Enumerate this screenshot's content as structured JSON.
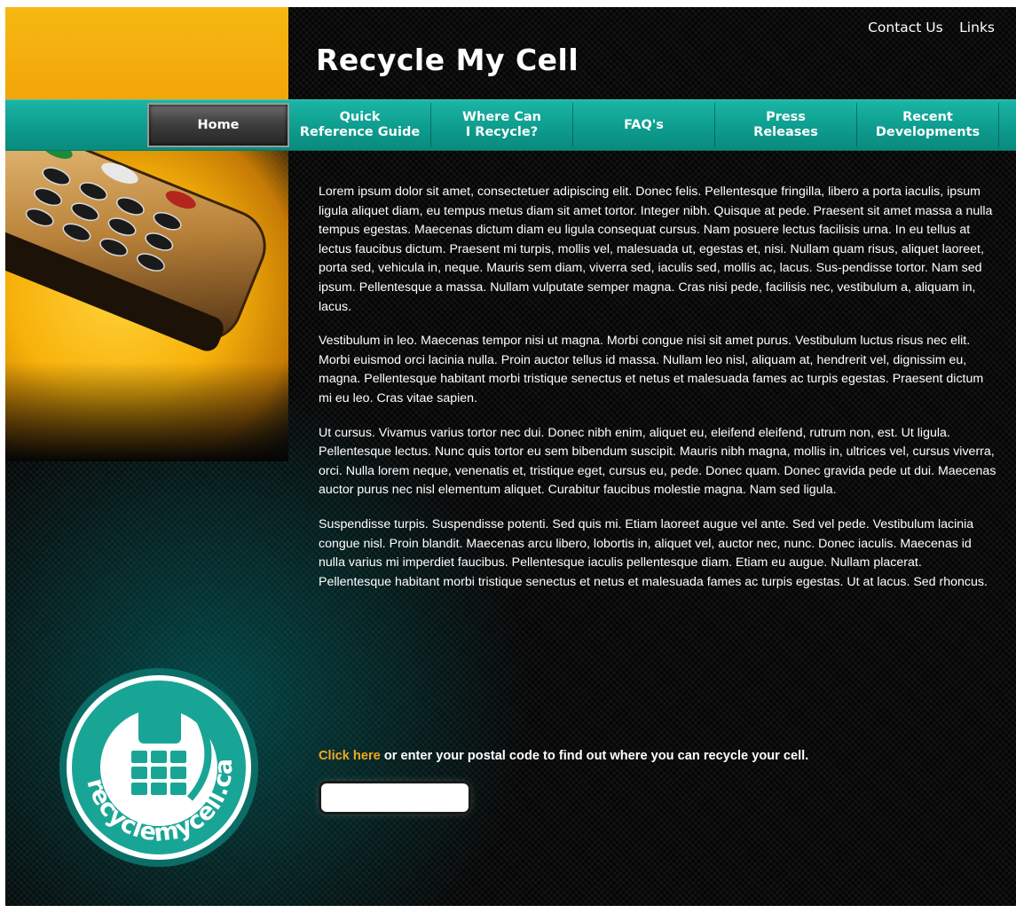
{
  "site": {
    "title": "Recycle My Cell"
  },
  "top_links": [
    "Contact Us",
    "Links"
  ],
  "nav": [
    {
      "label": "Home",
      "active": true
    },
    {
      "label": "Quick\nReference Guide",
      "active": false
    },
    {
      "label": "Where Can\nI Recycle?",
      "active": false
    },
    {
      "label": "FAQ's",
      "active": false
    },
    {
      "label": "Press\nReleases",
      "active": false
    },
    {
      "label": "Recent\nDevelopments",
      "active": false
    }
  ],
  "body_paragraphs": [
    "Lorem ipsum dolor sit amet, consectetuer adipiscing elit. Donec felis. Pellentesque fringilla, libero a porta iaculis, ipsum ligula aliquet diam, eu tempus metus diam sit amet tortor. Integer nibh. Quisque at pede. Praesent sit amet massa a nulla tempus egestas. Maecenas dictum diam eu ligula consequat cursus. Nam posuere lectus facilisis urna. In eu tellus at lectus faucibus dictum. Praesent mi turpis, mollis vel, malesuada ut, egestas et, nisi. Nullam quam risus, aliquet laoreet, porta sed, vehicula in, neque. Mauris sem diam, viverra sed, iaculis sed, mollis ac, lacus. Sus-pendisse tortor. Nam sed ipsum. Pellentesque a massa. Nullam vulputate semper magna. Cras nisi pede, facilisis nec, vestibulum a, aliquam in, lacus.",
    "Vestibulum in leo. Maecenas tempor nisi ut magna. Morbi congue nisi sit amet purus. Vestibulum luctus risus nec elit. Morbi euismod orci lacinia nulla. Proin auctor tellus id massa. Nullam leo nisl, aliquam at, hendrerit vel, dignissim eu, magna. Pellentesque habitant morbi tristique senectus et netus et malesuada fames ac turpis egestas. Praesent dictum mi eu leo. Cras vitae sapien.",
    "Ut cursus. Vivamus varius tortor nec dui. Donec nibh enim, aliquet eu, eleifend eleifend, rutrum non, est. Ut ligula. Pellentesque lectus. Nunc quis tortor eu sem bibendum suscipit. Mauris nibh magna, mollis in, ultrices vel, cursus viverra, orci. Nulla lorem neque, venenatis et, tristique eget, cursus eu, pede. Donec quam. Donec gravida pede ut dui. Maecenas auctor purus nec nisl elementum aliquet. Curabitur faucibus molestie magna. Nam sed ligula.",
    "Suspendisse turpis. Suspendisse potenti. Sed quis mi. Etiam laoreet augue vel ante. Sed vel pede. Vestibulum lacinia congue nisl. Proin blandit. Maecenas arcu libero, lobortis in, aliquet vel, auctor nec, nunc. Donec iaculis. Maecenas id nulla varius mi imperdiet faucibus. Pellentesque iaculis pellentesque diam. Etiam eu augue. Nullam placerat. Pellentesque habitant morbi tristique senectus et netus et malesuada fames ac turpis egestas. Ut at lacus. Sed rhoncus."
  ],
  "cta": {
    "link_text": "Click here",
    "rest_text": " or enter your postal code to find out where you can recycle your cell."
  },
  "postal_input": {
    "value": "",
    "placeholder": ""
  },
  "logo": {
    "text": "recyclemycell.ca"
  },
  "icons": {
    "phone_image": "cell-phone-photo",
    "logo": "recycle-seal-logo"
  },
  "colors": {
    "accent_teal": "#0d9d8e",
    "accent_orange": "#f2a50a",
    "link_orange": "#f0a820",
    "background": "#050505"
  }
}
